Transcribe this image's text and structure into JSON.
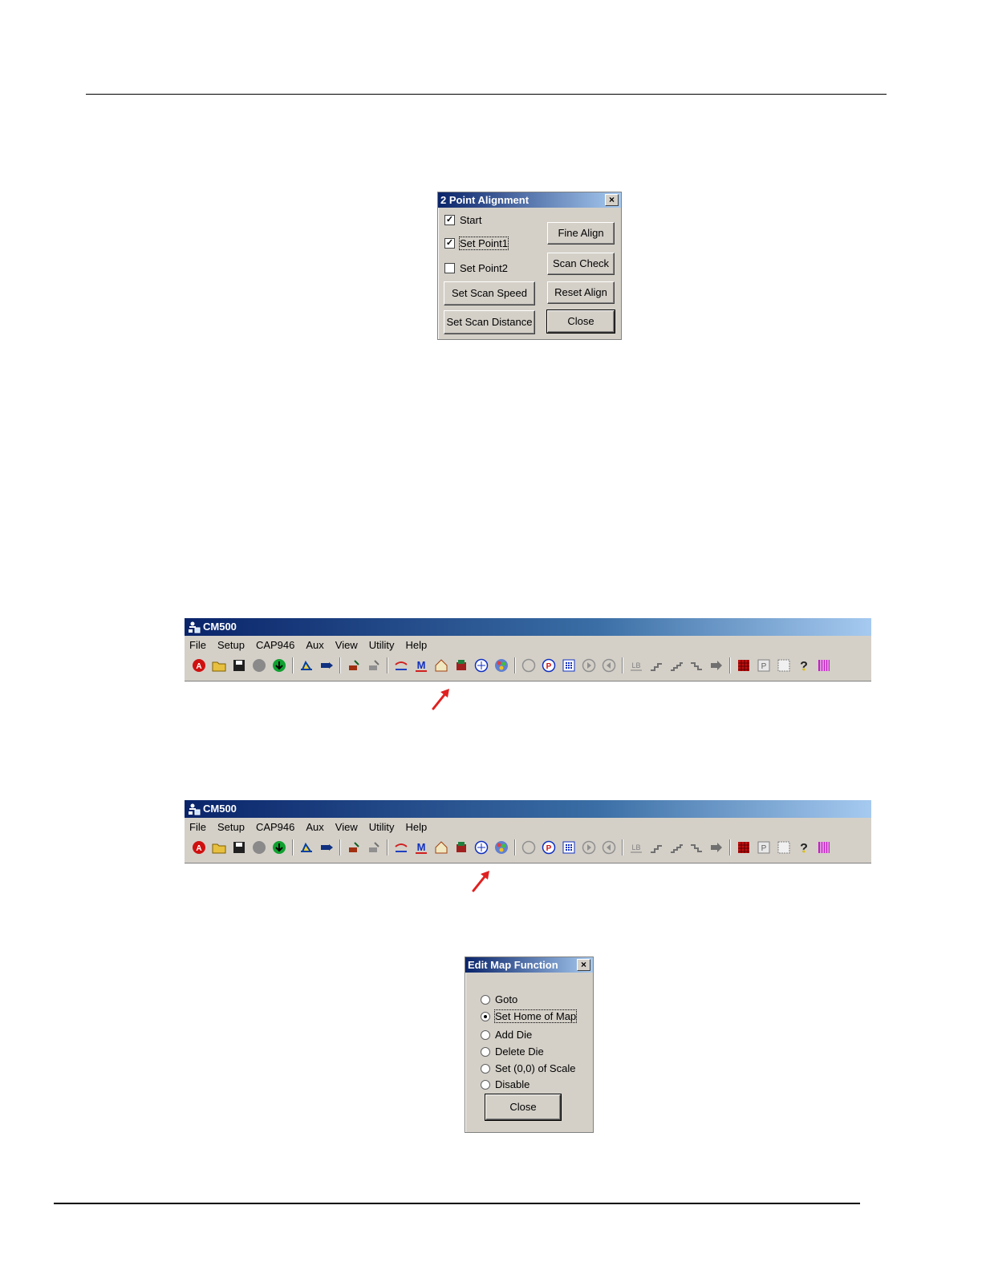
{
  "dialog_alignment": {
    "title": "2 Point Alignment",
    "close_glyph": "×",
    "checkboxes": [
      {
        "label": "Start",
        "checked": true
      },
      {
        "label": "Set Point1",
        "checked": true
      },
      {
        "label": "Set Point2",
        "checked": false
      }
    ],
    "buttons": {
      "fine_align": "Fine Align",
      "scan_check": "Scan Check",
      "reset_align": "Reset Align",
      "close": "Close",
      "set_scan_speed": "Set Scan Speed",
      "set_scan_distance": "Set Scan Distance"
    }
  },
  "app": {
    "title": "CM500",
    "menus": [
      "File",
      "Setup",
      "CAP946",
      "Aux",
      "View",
      "Utility",
      "Help"
    ],
    "toolbar_icons": [
      "alarm-icon",
      "open-folder-icon",
      "save-icon",
      "gray-circle-icon",
      "download-icon",
      "load-wafer-icon",
      "unload-icon",
      "stage-up-icon",
      "stage-down-icon",
      "align-icon",
      "map-icon",
      "home-icon",
      "die-icon",
      "target-icon",
      "color-wheel-icon",
      "probe-disabled-icon",
      "p-icon",
      "grid-icon",
      "step-forward-icon",
      "step-back-icon",
      "lb-icon",
      "step-up-icon",
      "step-up-2-icon",
      "step-down-icon",
      "next-icon",
      "red-grid-icon",
      "p-grid-icon",
      "dotted-grid-icon",
      "help-icon",
      "bars-icon"
    ]
  },
  "dialog_editmap": {
    "title": "Edit Map Function",
    "close_glyph": "×",
    "options": [
      {
        "label": "Goto",
        "selected": false
      },
      {
        "label": "Set Home of Map",
        "selected": true
      },
      {
        "label": "Add Die",
        "selected": false
      },
      {
        "label": "Delete Die",
        "selected": false
      },
      {
        "label": "Set (0,0) of Scale",
        "selected": false
      },
      {
        "label": "Disable",
        "selected": false
      }
    ],
    "close_button": "Close"
  },
  "colors": {
    "title_gradient_start": "#0a246a",
    "title_gradient_end": "#a6caf0",
    "dialog_face": "#d4d0c8",
    "annotation_arrow": "#e02020"
  }
}
